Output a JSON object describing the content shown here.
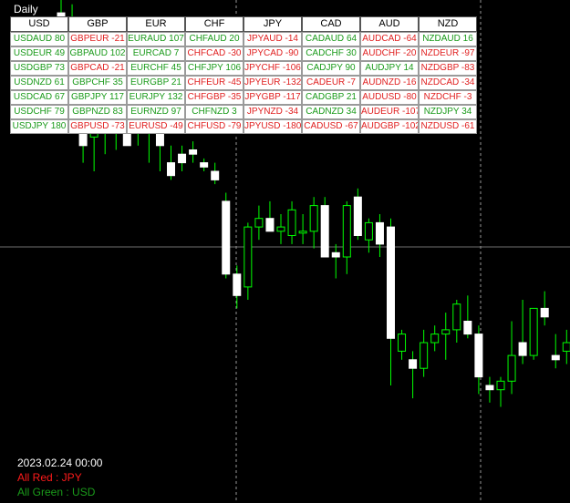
{
  "chart": {
    "timeframe": "Daily",
    "bull_color": "#ffffff",
    "bear_color": "#ffffff",
    "wick_color": "#00ff00",
    "grid_color": "#c0c0c0",
    "candles": [
      {
        "o": 0.97,
        "h": 1.01,
        "l": 0.9,
        "c": 0.96
      },
      {
        "o": 0.95,
        "h": 0.99,
        "l": 0.88,
        "c": 0.9
      },
      {
        "o": 0.9,
        "h": 0.94,
        "l": 0.62,
        "c": 0.66
      },
      {
        "o": 0.68,
        "h": 0.82,
        "l": 0.6,
        "c": 0.8
      },
      {
        "o": 0.72,
        "h": 0.76,
        "l": 0.64,
        "c": 0.7
      },
      {
        "o": 0.69,
        "h": 0.73,
        "l": 0.65,
        "c": 0.72
      },
      {
        "o": 0.69,
        "h": 0.72,
        "l": 0.66,
        "c": 0.66
      },
      {
        "o": 0.78,
        "h": 0.8,
        "l": 0.66,
        "c": 0.69
      },
      {
        "o": 0.77,
        "h": 0.84,
        "l": 0.62,
        "c": 0.69
      },
      {
        "o": 0.7,
        "h": 0.73,
        "l": 0.6,
        "c": 0.66
      },
      {
        "o": 0.62,
        "h": 0.66,
        "l": 0.58,
        "c": 0.59
      },
      {
        "o": 0.64,
        "h": 0.66,
        "l": 0.6,
        "c": 0.62
      },
      {
        "o": 0.65,
        "h": 0.67,
        "l": 0.62,
        "c": 0.64
      },
      {
        "o": 0.62,
        "h": 0.63,
        "l": 0.6,
        "c": 0.61
      },
      {
        "o": 0.6,
        "h": 0.62,
        "l": 0.57,
        "c": 0.58
      },
      {
        "o": 0.53,
        "h": 0.55,
        "l": 0.35,
        "c": 0.36
      },
      {
        "o": 0.36,
        "h": 0.38,
        "l": 0.28,
        "c": 0.31
      },
      {
        "o": 0.33,
        "h": 0.48,
        "l": 0.3,
        "c": 0.47
      },
      {
        "o": 0.47,
        "h": 0.52,
        "l": 0.44,
        "c": 0.49
      },
      {
        "o": 0.49,
        "h": 0.53,
        "l": 0.46,
        "c": 0.46
      },
      {
        "o": 0.46,
        "h": 0.5,
        "l": 0.43,
        "c": 0.47
      },
      {
        "o": 0.45,
        "h": 0.53,
        "l": 0.43,
        "c": 0.51
      },
      {
        "o": 0.46,
        "h": 0.5,
        "l": 0.43,
        "c": 0.46
      },
      {
        "o": 0.46,
        "h": 0.54,
        "l": 0.42,
        "c": 0.52
      },
      {
        "o": 0.52,
        "h": 0.54,
        "l": 0.44,
        "c": 0.4
      },
      {
        "o": 0.41,
        "h": 0.43,
        "l": 0.35,
        "c": 0.4
      },
      {
        "o": 0.4,
        "h": 0.53,
        "l": 0.36,
        "c": 0.52
      },
      {
        "o": 0.54,
        "h": 0.56,
        "l": 0.44,
        "c": 0.45
      },
      {
        "o": 0.44,
        "h": 0.49,
        "l": 0.41,
        "c": 0.48
      },
      {
        "o": 0.48,
        "h": 0.5,
        "l": 0.4,
        "c": 0.43
      },
      {
        "o": 0.47,
        "h": 0.49,
        "l": 0.1,
        "c": 0.21
      },
      {
        "o": 0.18,
        "h": 0.23,
        "l": 0.16,
        "c": 0.22
      },
      {
        "o": 0.16,
        "h": 0.18,
        "l": 0.07,
        "c": 0.14
      },
      {
        "o": 0.14,
        "h": 0.23,
        "l": 0.12,
        "c": 0.2
      },
      {
        "o": 0.2,
        "h": 0.24,
        "l": 0.18,
        "c": 0.22
      },
      {
        "o": 0.22,
        "h": 0.27,
        "l": 0.16,
        "c": 0.23
      },
      {
        "o": 0.23,
        "h": 0.3,
        "l": 0.2,
        "c": 0.29
      },
      {
        "o": 0.25,
        "h": 0.31,
        "l": 0.21,
        "c": 0.22
      },
      {
        "o": 0.22,
        "h": 0.24,
        "l": 0.08,
        "c": 0.12
      },
      {
        "o": 0.1,
        "h": 0.12,
        "l": 0.06,
        "c": 0.09
      },
      {
        "o": 0.09,
        "h": 0.12,
        "l": 0.05,
        "c": 0.11
      },
      {
        "o": 0.11,
        "h": 0.25,
        "l": 0.08,
        "c": 0.17
      },
      {
        "o": 0.2,
        "h": 0.3,
        "l": 0.15,
        "c": 0.17
      },
      {
        "o": 0.17,
        "h": 0.26,
        "l": 0.16,
        "c": 0.28
      },
      {
        "o": 0.28,
        "h": 0.32,
        "l": 0.24,
        "c": 0.26
      },
      {
        "o": 0.17,
        "h": 0.22,
        "l": 0.14,
        "c": 0.16
      },
      {
        "o": 0.18,
        "h": 0.23,
        "l": 0.15,
        "c": 0.2
      },
      {
        "o": 0.2,
        "h": 0.24,
        "l": 0.16,
        "c": 0.18
      },
      {
        "o": 0.16,
        "h": 0.18,
        "l": 0.12,
        "c": 0.14
      }
    ]
  },
  "matrix": {
    "headers": [
      "USD",
      "GBP",
      "EUR",
      "CHF",
      "JPY",
      "CAD",
      "AUD",
      "NZD"
    ],
    "columns": [
      [
        {
          "pair": "USDAUD",
          "value": "80",
          "sign": "pos"
        },
        {
          "pair": "USDEUR",
          "value": "49",
          "sign": "pos"
        },
        {
          "pair": "USDGBP",
          "value": "73",
          "sign": "pos"
        },
        {
          "pair": "USDNZD",
          "value": "61",
          "sign": "pos"
        },
        {
          "pair": "USDCAD",
          "value": "67",
          "sign": "pos"
        },
        {
          "pair": "USDCHF",
          "value": "79",
          "sign": "pos"
        },
        {
          "pair": "USDJPY",
          "value": "180",
          "sign": "pos"
        }
      ],
      [
        {
          "pair": "GBPEUR",
          "value": "-21",
          "sign": "neg"
        },
        {
          "pair": "GBPAUD",
          "value": "102",
          "sign": "pos"
        },
        {
          "pair": "GBPCAD",
          "value": "-21",
          "sign": "neg"
        },
        {
          "pair": "GBPCHF",
          "value": "35",
          "sign": "pos"
        },
        {
          "pair": "GBPJPY",
          "value": "117",
          "sign": "pos"
        },
        {
          "pair": "GBPNZD",
          "value": "83",
          "sign": "pos"
        },
        {
          "pair": "GBPUSD",
          "value": "-73",
          "sign": "neg"
        }
      ],
      [
        {
          "pair": "EURAUD",
          "value": "107",
          "sign": "pos"
        },
        {
          "pair": "EURCAD",
          "value": "7",
          "sign": "pos"
        },
        {
          "pair": "EURCHF",
          "value": "45",
          "sign": "pos"
        },
        {
          "pair": "EURGBP",
          "value": "21",
          "sign": "pos"
        },
        {
          "pair": "EURJPY",
          "value": "132",
          "sign": "pos"
        },
        {
          "pair": "EURNZD",
          "value": "97",
          "sign": "pos"
        },
        {
          "pair": "EURUSD",
          "value": "-49",
          "sign": "neg"
        }
      ],
      [
        {
          "pair": "CHFAUD",
          "value": "20",
          "sign": "pos"
        },
        {
          "pair": "CHFCAD",
          "value": "-30",
          "sign": "neg"
        },
        {
          "pair": "CHFJPY",
          "value": "106",
          "sign": "pos"
        },
        {
          "pair": "CHFEUR",
          "value": "-45",
          "sign": "neg"
        },
        {
          "pair": "CHFGBP",
          "value": "-35",
          "sign": "neg"
        },
        {
          "pair": "CHFNZD",
          "value": "3",
          "sign": "pos"
        },
        {
          "pair": "CHFUSD",
          "value": "-79",
          "sign": "neg"
        }
      ],
      [
        {
          "pair": "JPYAUD",
          "value": "-14",
          "sign": "neg"
        },
        {
          "pair": "JPYCAD",
          "value": "-90",
          "sign": "neg"
        },
        {
          "pair": "JPYCHF",
          "value": "-106",
          "sign": "neg"
        },
        {
          "pair": "JPYEUR",
          "value": "-132",
          "sign": "neg"
        },
        {
          "pair": "JPYGBP",
          "value": "-117",
          "sign": "neg"
        },
        {
          "pair": "JPYNZD",
          "value": "-34",
          "sign": "neg"
        },
        {
          "pair": "JPYUSD",
          "value": "-180",
          "sign": "neg"
        }
      ],
      [
        {
          "pair": "CADAUD",
          "value": "64",
          "sign": "pos"
        },
        {
          "pair": "CADCHF",
          "value": "30",
          "sign": "pos"
        },
        {
          "pair": "CADJPY",
          "value": "90",
          "sign": "pos"
        },
        {
          "pair": "CADEUR",
          "value": "-7",
          "sign": "neg"
        },
        {
          "pair": "CADGBP",
          "value": "21",
          "sign": "pos"
        },
        {
          "pair": "CADNZD",
          "value": "34",
          "sign": "pos"
        },
        {
          "pair": "CADUSD",
          "value": "-67",
          "sign": "neg"
        }
      ],
      [
        {
          "pair": "AUDCAD",
          "value": "-64",
          "sign": "neg"
        },
        {
          "pair": "AUDCHF",
          "value": "-20",
          "sign": "neg"
        },
        {
          "pair": "AUDJPY",
          "value": "14",
          "sign": "pos"
        },
        {
          "pair": "AUDNZD",
          "value": "-16",
          "sign": "neg"
        },
        {
          "pair": "AUDUSD",
          "value": "-80",
          "sign": "neg"
        },
        {
          "pair": "AUDEUR",
          "value": "-107",
          "sign": "neg"
        },
        {
          "pair": "AUDGBP",
          "value": "-102",
          "sign": "neg"
        }
      ],
      [
        {
          "pair": "NZDAUD",
          "value": "16",
          "sign": "pos"
        },
        {
          "pair": "NZDEUR",
          "value": "-97",
          "sign": "neg"
        },
        {
          "pair": "NZDGBP",
          "value": "-83",
          "sign": "neg"
        },
        {
          "pair": "NZDCAD",
          "value": "-34",
          "sign": "neg"
        },
        {
          "pair": "NZDCHF",
          "value": "-3",
          "sign": "neg"
        },
        {
          "pair": "NZDJPY",
          "value": "34",
          "sign": "pos"
        },
        {
          "pair": "NZDUSD",
          "value": "-61",
          "sign": "neg"
        }
      ]
    ]
  },
  "info": {
    "date": "2023.02.24 00:00",
    "all_red": "All Red : JPY",
    "all_green": "All Green : USD"
  }
}
